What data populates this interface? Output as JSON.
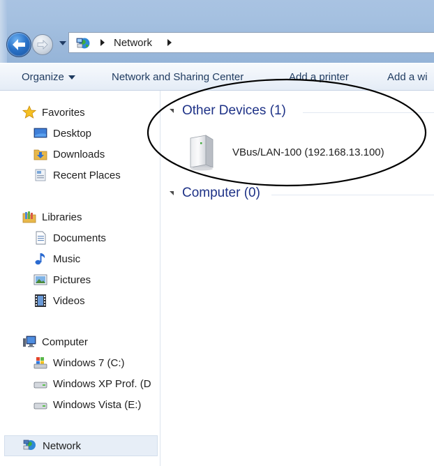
{
  "address_bar": {
    "crumbs": [
      "Network"
    ],
    "icons": [
      "back-arrow-icon",
      "forward-arrow-icon",
      "dropdown-arrow-icon",
      "network-icon",
      "breadcrumb-arrow-icon"
    ]
  },
  "toolbar": {
    "organize_label": "Organize",
    "sharing_center_label": "Network and Sharing Center",
    "add_printer_label": "Add a printer",
    "add_wireless_label": "Add a wi"
  },
  "nav": {
    "favorites": {
      "label": "Favorites",
      "items": [
        {
          "label": "Desktop"
        },
        {
          "label": "Downloads"
        },
        {
          "label": "Recent Places"
        }
      ]
    },
    "libraries": {
      "label": "Libraries",
      "items": [
        {
          "label": "Documents"
        },
        {
          "label": "Music"
        },
        {
          "label": "Pictures"
        },
        {
          "label": "Videos"
        }
      ]
    },
    "computer": {
      "label": "Computer",
      "items": [
        {
          "label": "Windows 7 (C:)"
        },
        {
          "label": "Windows XP Prof. (D"
        },
        {
          "label": "Windows Vista (E:)"
        }
      ]
    },
    "network": {
      "label": "Network"
    }
  },
  "content": {
    "groups": [
      {
        "title": "Other Devices (1)",
        "items": [
          {
            "label": "VBus/LAN-100 (192.168.13.100)"
          }
        ]
      },
      {
        "title": "Computer (0)",
        "items": []
      }
    ]
  },
  "colors": {
    "group_header": "#1e3287",
    "callout": "#000000",
    "nav_selected": "#e7eef7"
  }
}
